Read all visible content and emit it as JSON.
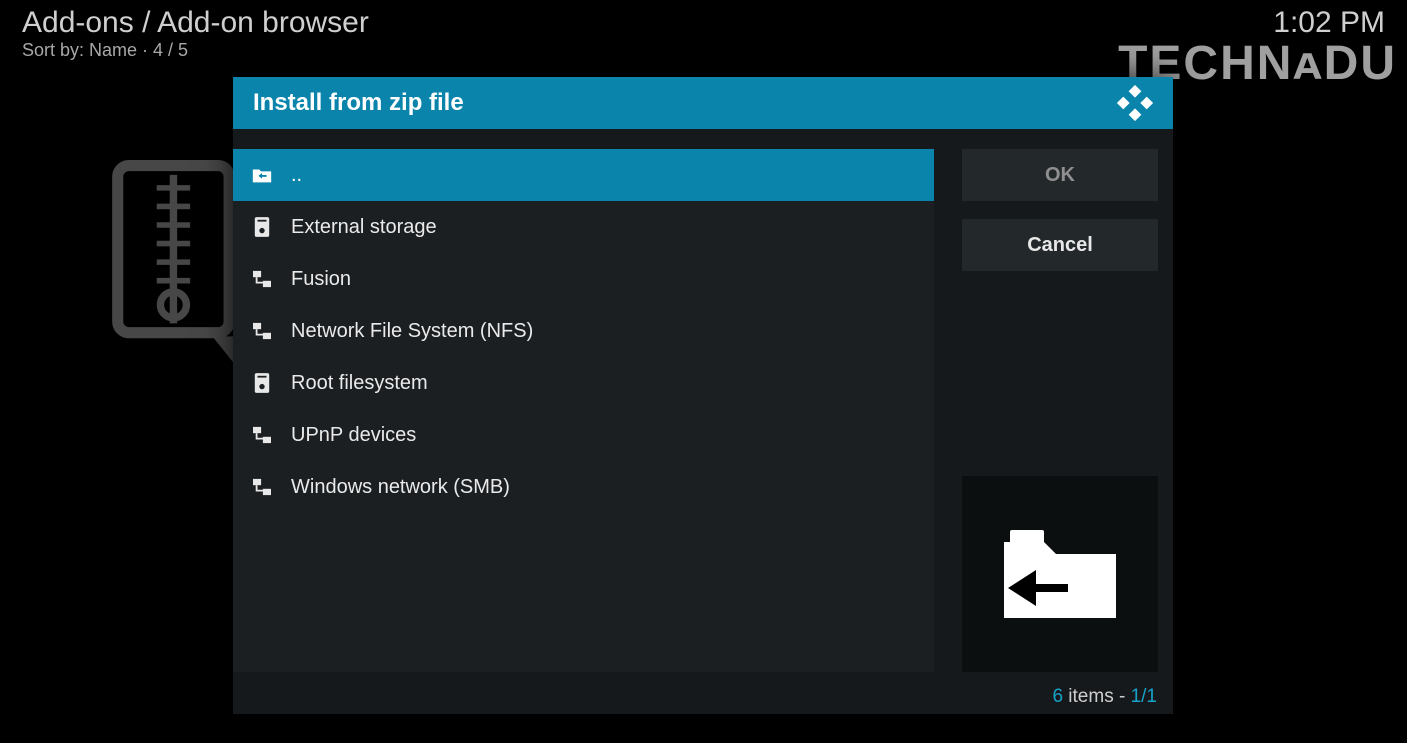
{
  "header": {
    "breadcrumb": "Add-ons / Add-on browser",
    "sort_line": "Sort by: Name  ·  4 / 5",
    "clock": "1:02 PM",
    "watermark": "TECHNᴀDU"
  },
  "dialog": {
    "title": "Install from zip file",
    "items": [
      {
        "icon": "folder-up",
        "label": "..",
        "selected": true
      },
      {
        "icon": "disk",
        "label": "External storage",
        "selected": false
      },
      {
        "icon": "network",
        "label": "Fusion",
        "selected": false
      },
      {
        "icon": "network",
        "label": "Network File System (NFS)",
        "selected": false
      },
      {
        "icon": "disk",
        "label": "Root filesystem",
        "selected": false
      },
      {
        "icon": "network",
        "label": "UPnP devices",
        "selected": false
      },
      {
        "icon": "network",
        "label": "Windows network (SMB)",
        "selected": false
      }
    ],
    "buttons": {
      "ok": "OK",
      "cancel": "Cancel"
    },
    "status_prefix": "6",
    "status_items_word": " items - ",
    "status_page": "1/1"
  }
}
